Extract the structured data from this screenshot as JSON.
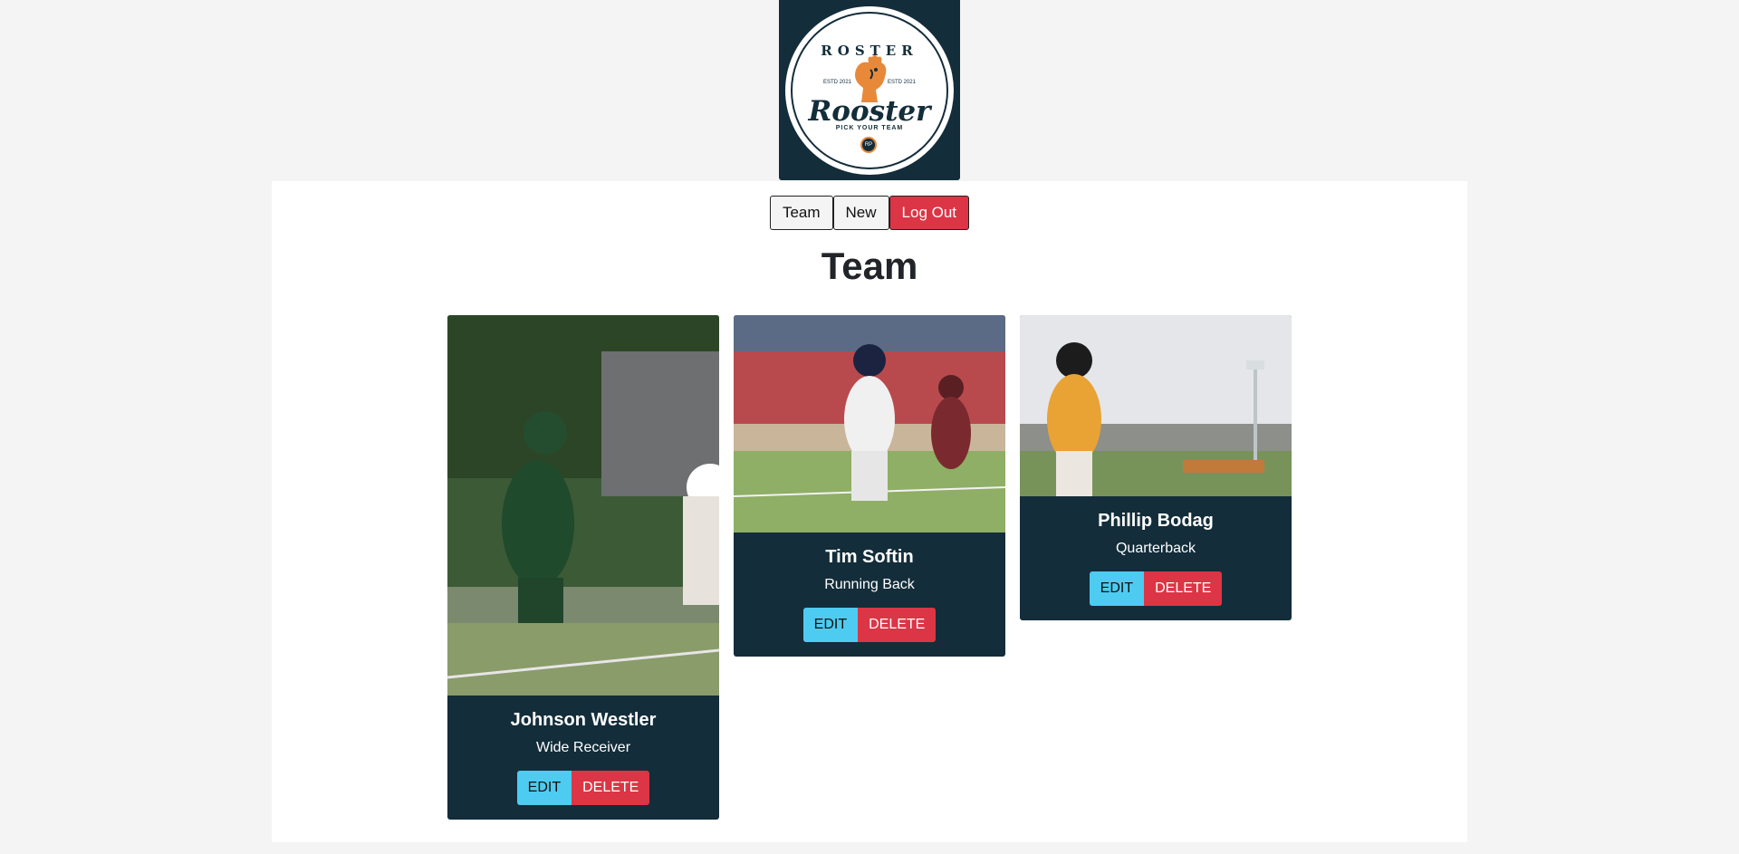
{
  "logo": {
    "arc_text": "ROSTER",
    "word": "Rooster",
    "tagline": "PICK YOUR TEAM",
    "est_left": "ESTD 2021",
    "est_right": "ESTD 2021",
    "badge": "RP",
    "colors": {
      "navy": "#132d3a",
      "orange": "#e8893a"
    }
  },
  "nav": {
    "team_label": "Team",
    "new_label": "New",
    "logout_label": "Log Out"
  },
  "page": {
    "title": "Team"
  },
  "players": [
    {
      "name": "Johnson Westler",
      "position": "Wide Receiver",
      "edit_label": "EDIT",
      "delete_label": "DELETE"
    },
    {
      "name": "Tim Softin",
      "position": "Running Back",
      "edit_label": "EDIT",
      "delete_label": "DELETE"
    },
    {
      "name": "Phillip Bodag",
      "position": "Quarterback",
      "edit_label": "EDIT",
      "delete_label": "DELETE"
    }
  ],
  "colors": {
    "card_bg": "#132d3a",
    "edit": "#4ecbf0",
    "delete": "#dc3545",
    "page_bg": "#f4f4f4"
  }
}
